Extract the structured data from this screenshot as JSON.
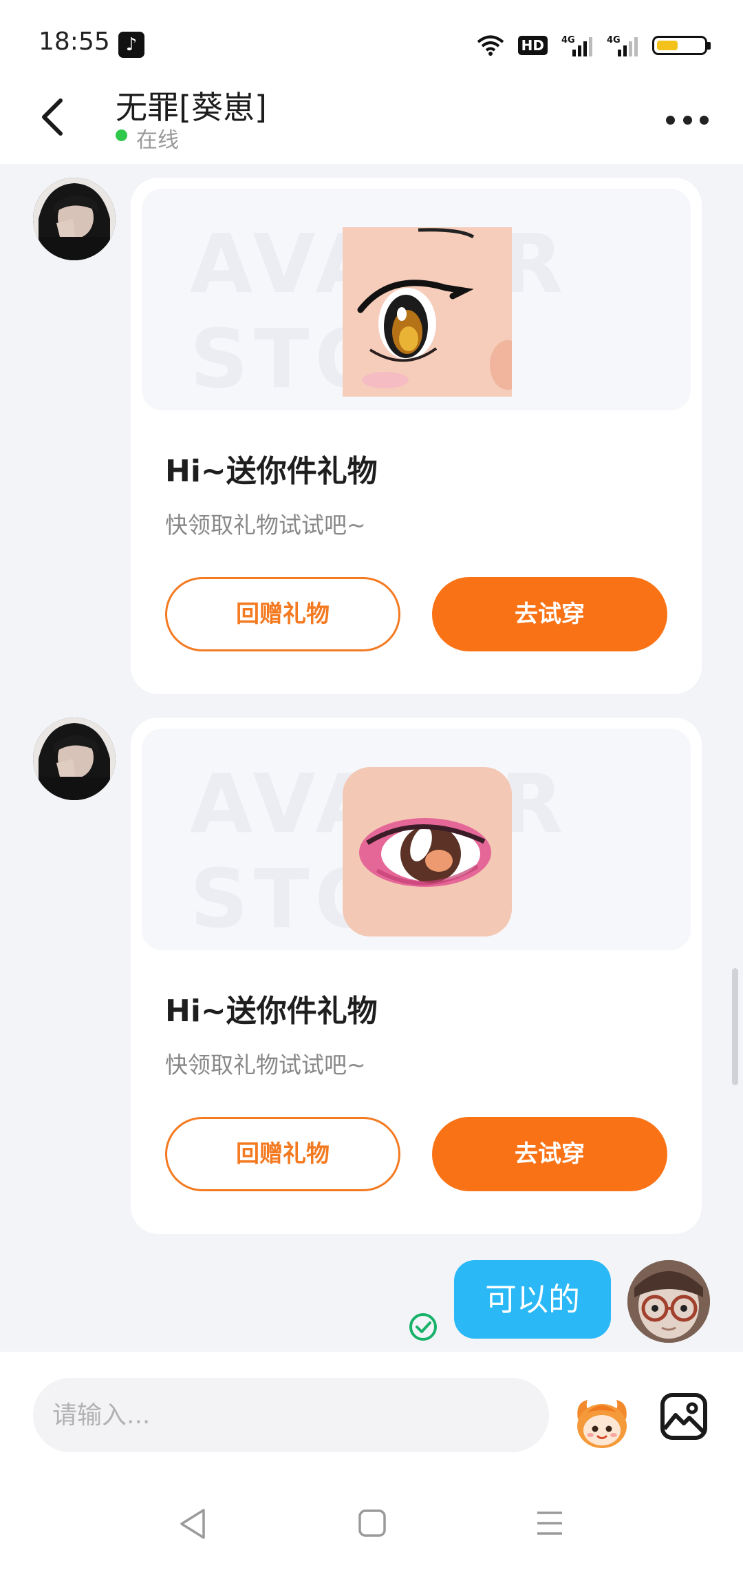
{
  "status_bar": {
    "time": "18:55",
    "app_icon": "tiktok-icon",
    "hd_label": "HD",
    "network_1": "4G",
    "network_2": "4G",
    "battery_level": 0.45
  },
  "header": {
    "title": "无罪[葵崽]",
    "status": "在线",
    "back_icon": "chevron-left-icon",
    "more_icon": "more-horizontal-icon"
  },
  "messages": [
    {
      "sender": "other",
      "type": "gift",
      "watermark": "AVATAR STORE",
      "title": "Hi~送你件礼物",
      "subtitle": "快领取礼物试试吧~",
      "return_label": "回赠礼物",
      "try_label": "去试穿"
    },
    {
      "sender": "other",
      "type": "gift",
      "watermark": "AVATAR STORE",
      "title": "Hi~送你件礼物",
      "subtitle": "快领取礼物试试吧~",
      "return_label": "回赠礼物",
      "try_label": "去试穿"
    },
    {
      "sender": "me",
      "type": "text",
      "text": "可以的",
      "read": true
    }
  ],
  "input": {
    "placeholder": "请输入..."
  },
  "colors": {
    "accent_orange": "#f97316",
    "bubble_blue": "#2ab8f6",
    "online_green": "#2ec84a",
    "background": "#f3f4f8"
  }
}
